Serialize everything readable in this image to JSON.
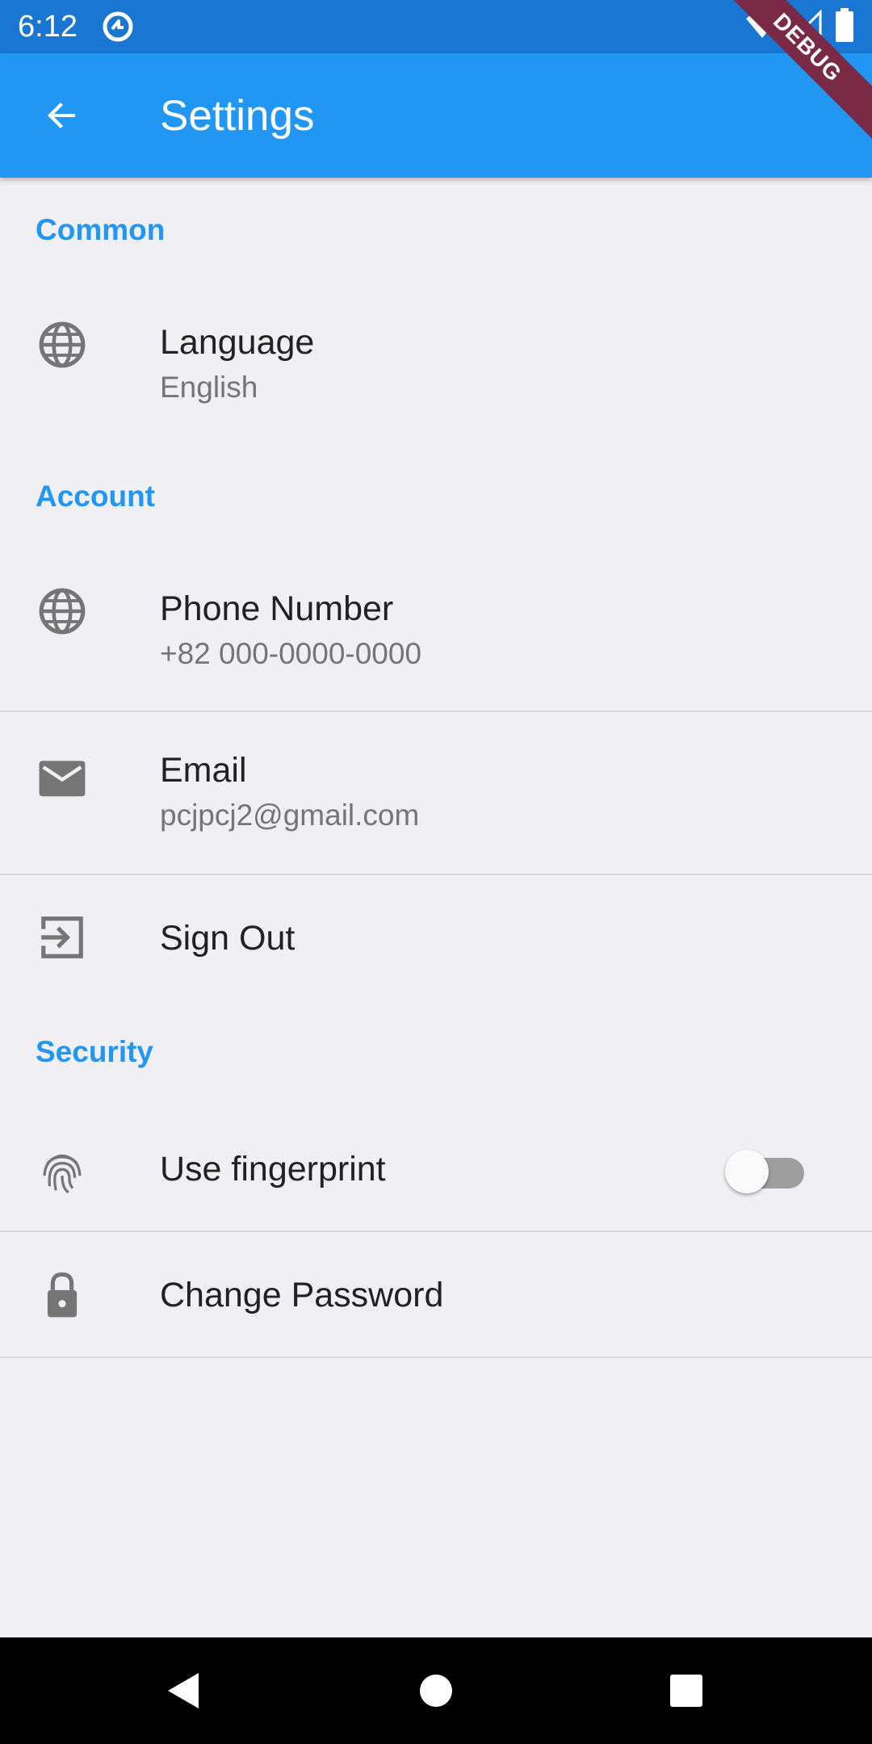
{
  "status_bar": {
    "time": "6:12",
    "icons": [
      "app-notification-icon",
      "wifi-icon",
      "signal-icon",
      "battery-icon"
    ]
  },
  "app_bar": {
    "title": "Settings",
    "back_icon": "arrow-back-icon",
    "color": "#2196f3"
  },
  "debug_banner": "DEBUG",
  "sections": {
    "common": {
      "title": "Common",
      "tiles": {
        "language": {
          "title": "Language",
          "subtitle": "English",
          "icon": "globe-icon"
        }
      }
    },
    "account": {
      "title": "Account",
      "tiles": {
        "phone": {
          "title": "Phone Number",
          "subtitle": "+82 000-0000-0000",
          "icon": "globe-icon"
        },
        "email": {
          "title": "Email",
          "subtitle": "pcjpcj2@gmail.com",
          "icon": "mail-icon"
        },
        "sign_out": {
          "title": "Sign Out",
          "icon": "exit-icon"
        }
      }
    },
    "security": {
      "title": "Security",
      "tiles": {
        "fingerprint": {
          "title": "Use fingerprint",
          "icon": "fingerprint-icon",
          "toggle_on": false
        },
        "change_password": {
          "title": "Change Password",
          "icon": "lock-icon"
        }
      }
    }
  },
  "nav_bar": {
    "buttons": [
      "back-triangle-icon",
      "home-circle-icon",
      "recents-square-icon"
    ]
  }
}
